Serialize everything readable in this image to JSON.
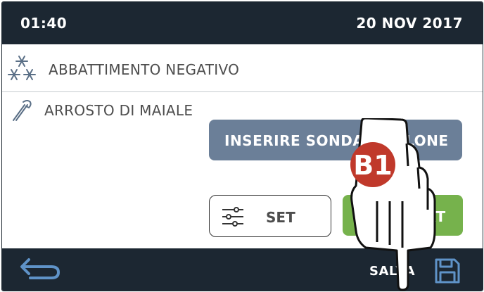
{
  "status_bar": {
    "time": "01:40",
    "date": "20 NOV 2017"
  },
  "cycle": {
    "mode_label": "ABBATTIMENTO NEGATIVO",
    "mode_icon": "snowflakes-icon"
  },
  "recipe": {
    "name": "ARROSTO DI MAIALE",
    "icon": "probe-icon"
  },
  "buttons": {
    "insert_probe_label": "INSERIRE SONDA SPILLONE",
    "set_label": "SET",
    "start_label": "START"
  },
  "bottom_bar": {
    "back_icon": "back-arrow-icon",
    "save_label": "SALVA",
    "save_icon": "floppy-disk-icon"
  },
  "overlay": {
    "badge_text": "B1",
    "badge_color": "#c0392b",
    "hand_icon": "pointing-hand-icon"
  },
  "colors": {
    "bar": "#1c2732",
    "probe_button": "#6b7f98",
    "start_button": "#76b24c"
  }
}
